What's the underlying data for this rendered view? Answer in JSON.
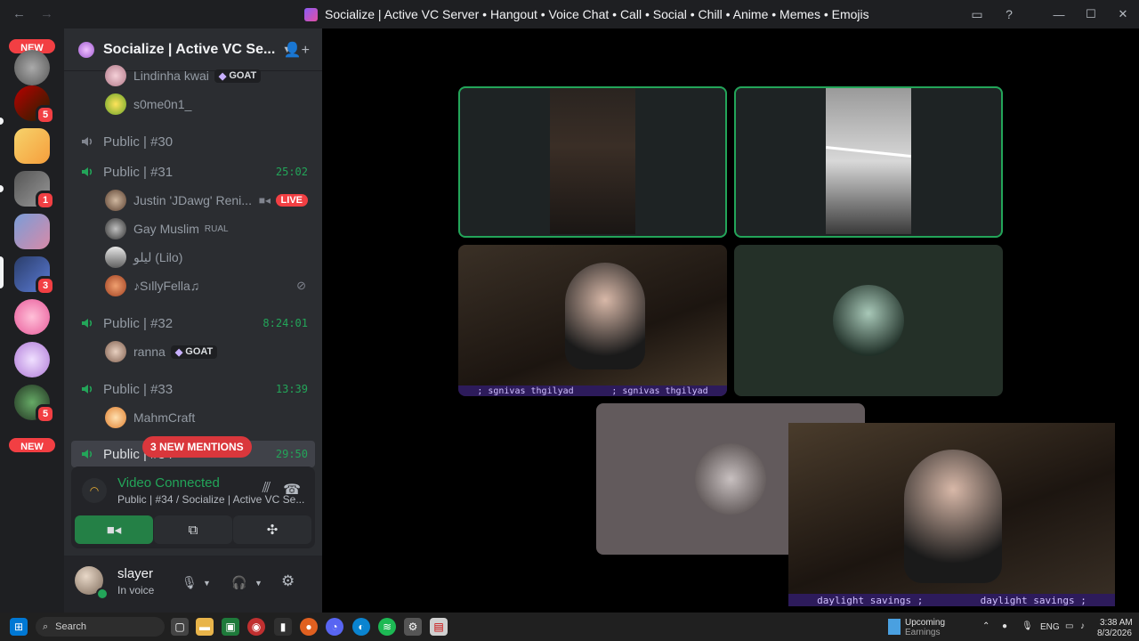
{
  "window": {
    "title": "Socialize | Active VC Server • Hangout • Voice Chat • Call • Social • Chill • Anime • Memes • Emojis"
  },
  "guilds": {
    "new_label": "NEW",
    "badges": [
      "5",
      "1",
      "3",
      "5"
    ]
  },
  "server": {
    "name": "Socialize | Active VC Se..."
  },
  "channels": [
    {
      "name": "Public | #30",
      "timer": ""
    },
    {
      "name": "Public | #31",
      "timer": "25:02"
    },
    {
      "name": "Public | #32",
      "timer": "8:24:01"
    },
    {
      "name": "Public | #33",
      "timer": "13:39"
    },
    {
      "name": "Public | #34",
      "timer": "29:50"
    }
  ],
  "users": {
    "u1": {
      "name": "Lindinha kwai",
      "tag": "GOAT"
    },
    "u2": {
      "name": "s0me0n1_"
    },
    "u3": {
      "name": "Justin 'JDawg' Reni...",
      "live": "LIVE"
    },
    "u4": {
      "name": "Gay Muslim",
      "tag": "RUAL"
    },
    "u5": {
      "name": "ليلو (Lilo)"
    },
    "u6": {
      "name": "♪SıllyFella♫"
    },
    "u7": {
      "name": "ranna",
      "tag": "GOAT"
    },
    "u8": {
      "name": "MahmCraft"
    }
  },
  "mentions": "3 NEW MENTIONS",
  "voice": {
    "status": "Video Connected",
    "channel": "Public | #34 / Socialize | Active VC Se..."
  },
  "me": {
    "name": "slayer",
    "status": "In voice"
  },
  "overlay_text": {
    "small_left": "; sgnivas thgilyad",
    "small_right": "; sgnivas thgilyad",
    "large_left": "daylight savings ;",
    "large_right": "daylight savings ;"
  },
  "taskbar": {
    "search": "Search",
    "news_title": "Upcoming",
    "news_sub": "Earnings",
    "lang": "ENG",
    "time": "3:38 AM",
    "date": "8/3/2026"
  },
  "colors": {
    "accent_green": "#23a559",
    "danger_red": "#f23f43",
    "bg_sidebar": "#2b2d31",
    "bg_guilds": "#1e1f22"
  }
}
